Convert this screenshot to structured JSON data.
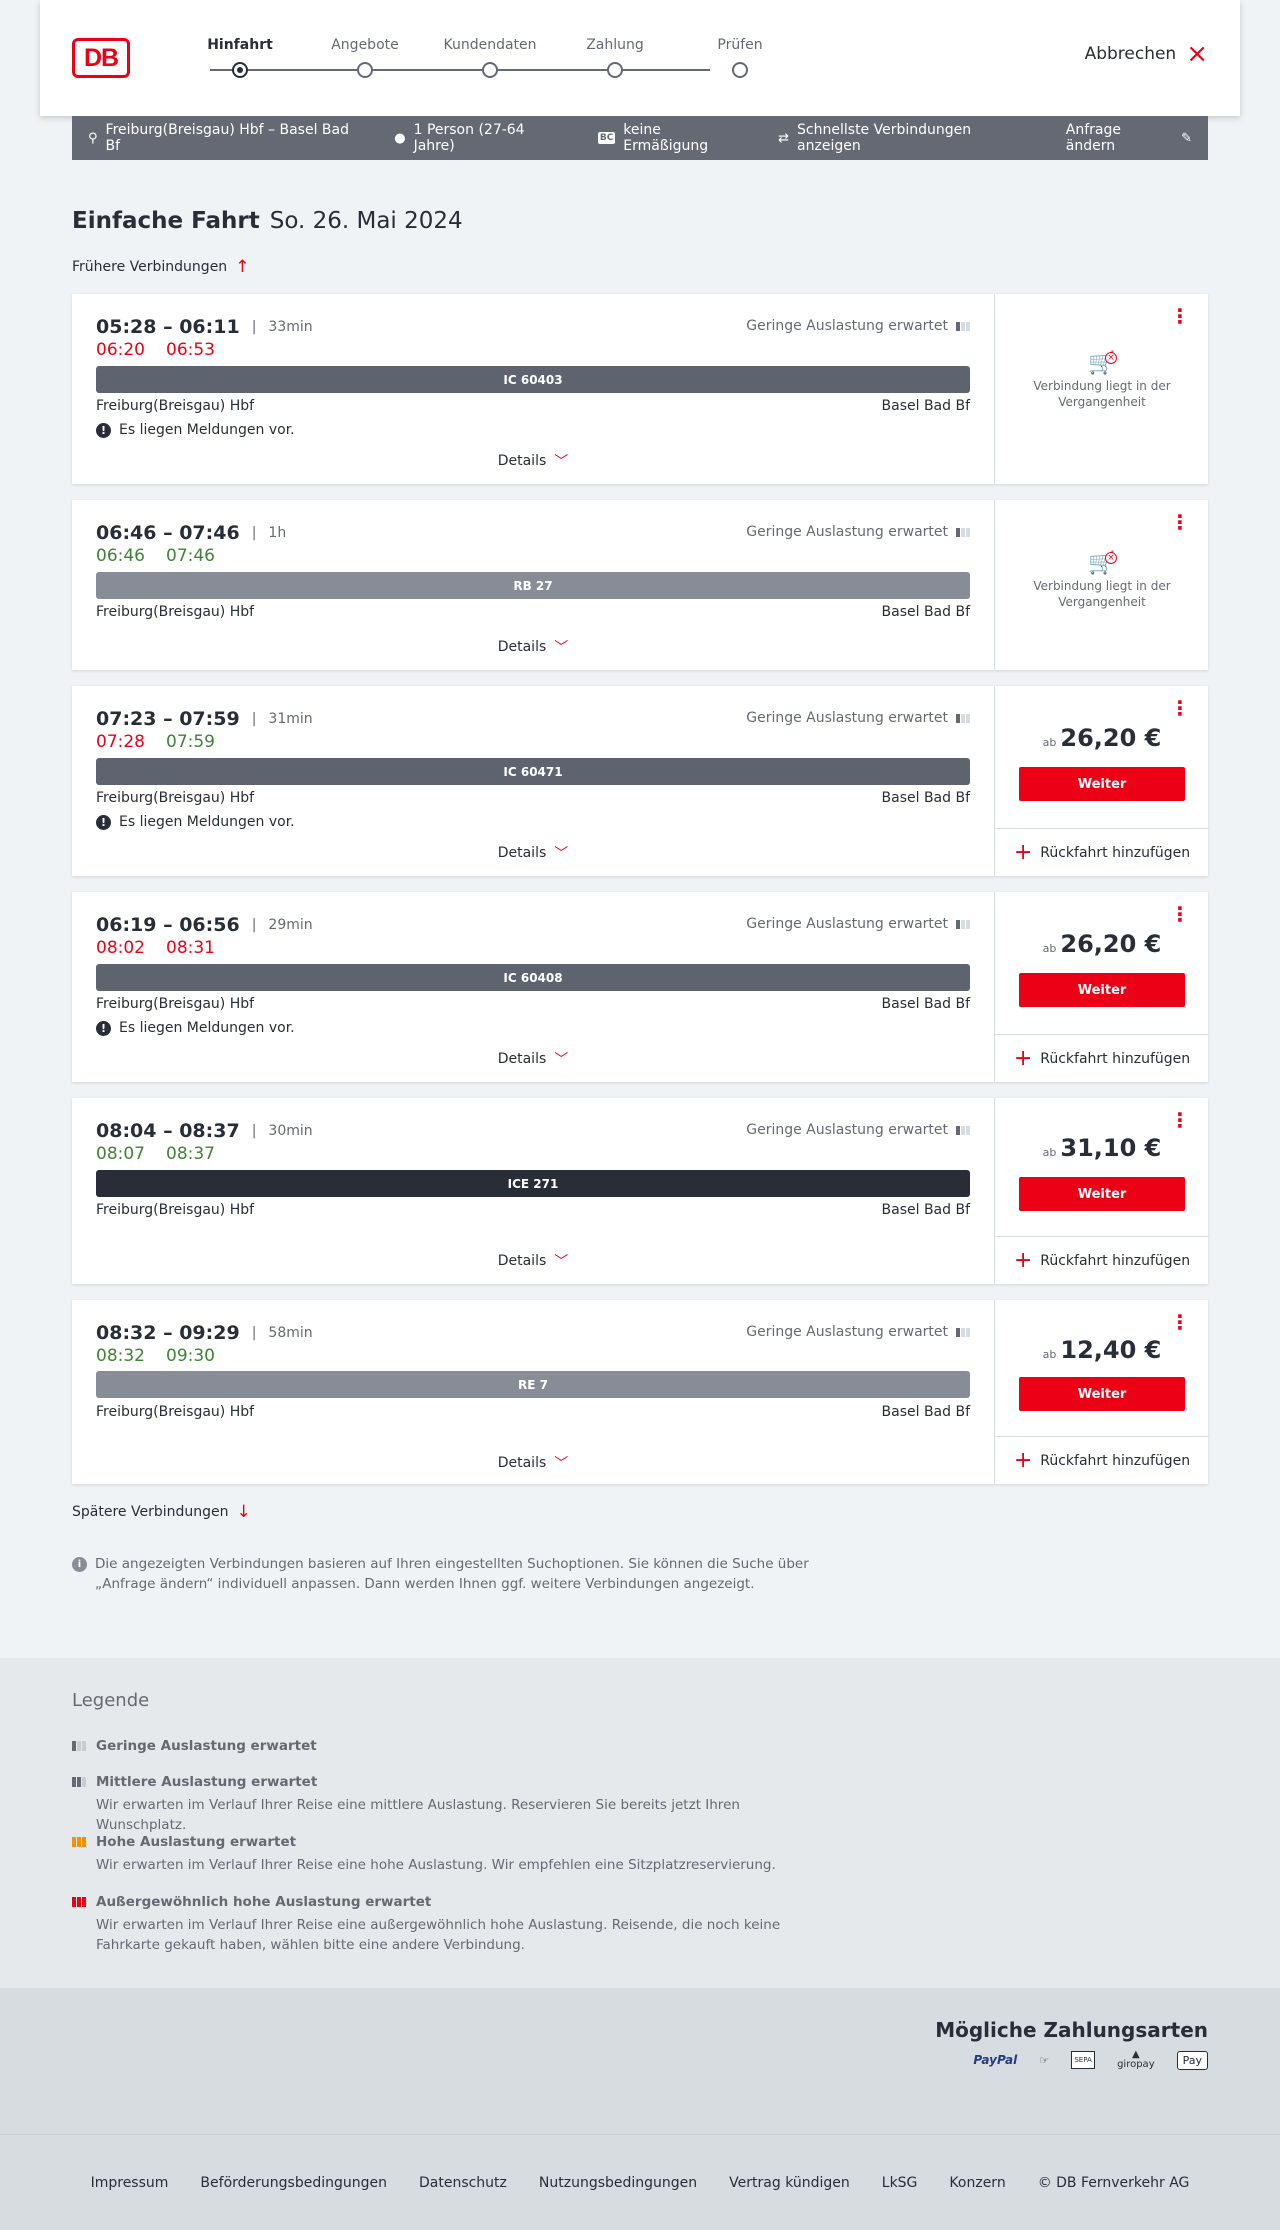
{
  "header": {
    "logo": "DB",
    "steps": [
      "Hinfahrt",
      "Angebote",
      "Kundendaten",
      "Zahlung",
      "Prüfen"
    ],
    "cancel_label": "Abbrechen"
  },
  "summary": {
    "route": "Freiburg(Breisgau) Hbf – Basel Bad Bf",
    "passengers": "1 Person (27-64 Jahre)",
    "discount_badge": "BC",
    "discount": "keine Ermäßigung",
    "option": "Schnellste Verbindungen anzeigen",
    "change": "Anfrage ändern"
  },
  "heading": {
    "title": "Einfache Fahrt",
    "date": "So. 26. Mai 2024"
  },
  "earlier_label": "Frühere Verbindungen",
  "later_label": "Spätere Verbindungen",
  "connections": [
    {
      "times": "05:28 – 06:11",
      "duration": "33min",
      "rt_dep": "06:20",
      "rt_arr": "06:53",
      "rt_color": "red",
      "load": "Geringe Auslastung erwartet",
      "train": "IC 60403",
      "from": "Freiburg(Breisgau) Hbf",
      "to": "Basel Bad Bf",
      "message": "Es liegen Meldungen vor.",
      "details": "Details",
      "past": "Verbindung liegt in der Vergangenheit"
    },
    {
      "times": "06:46 – 07:46",
      "duration": "1h",
      "rt_dep": "06:46",
      "rt_arr": "07:46",
      "rt_color": "green",
      "load": "Geringe Auslastung erwartet",
      "train": "RB 27",
      "from": "Freiburg(Breisgau) Hbf",
      "to": "Basel Bad Bf",
      "details": "Details",
      "past": "Verbindung liegt in der Vergangenheit"
    },
    {
      "times": "07:23 – 07:59",
      "duration": "31min",
      "rt_dep": "07:28",
      "rt_arr": "07:59",
      "load": "Geringe Auslastung erwartet",
      "train": "IC 60471",
      "from": "Freiburg(Breisgau) Hbf",
      "to": "Basel Bad Bf",
      "message": "Es liegen Meldungen vor.",
      "details": "Details",
      "price_prefix": "ab",
      "price": "26,20 €",
      "cta": "Weiter",
      "return": "Rückfahrt hinzufügen"
    },
    {
      "times": "06:19 – 06:56",
      "duration": "29min",
      "rt_dep": "08:02",
      "rt_arr": "08:31",
      "load": "Geringe Auslastung erwartet",
      "train": "IC 60408",
      "from": "Freiburg(Breisgau) Hbf",
      "to": "Basel Bad Bf",
      "message": "Es liegen Meldungen vor.",
      "details": "Details",
      "price_prefix": "ab",
      "price": "26,20 €",
      "cta": "Weiter",
      "return": "Rückfahrt hinzufügen"
    },
    {
      "times": "08:04 – 08:37",
      "duration": "30min",
      "rt_dep": "08:07",
      "rt_arr": "08:37",
      "load": "Geringe Auslastung erwartet",
      "train": "ICE 271",
      "from": "Freiburg(Breisgau) Hbf",
      "to": "Basel Bad Bf",
      "details": "Details",
      "price_prefix": "ab",
      "price": "31,10 €",
      "cta": "Weiter",
      "return": "Rückfahrt hinzufügen"
    },
    {
      "times": "08:32 – 09:29",
      "duration": "58min",
      "rt_dep": "08:32",
      "rt_arr": "09:30",
      "load": "Geringe Auslastung erwartet",
      "train": "RE 7",
      "from": "Freiburg(Breisgau) Hbf",
      "to": "Basel Bad Bf",
      "details": "Details",
      "price_prefix": "ab",
      "price": "12,40 €",
      "cta": "Weiter",
      "return": "Rückfahrt hinzufügen"
    }
  ],
  "info_text": "Die angezeigten Verbindungen basieren auf Ihren eingestellten Suchoptionen. Sie können die Suche über „Anfrage ändern“ individuell anpassen. Dann werden Ihnen ggf. weitere Verbindungen angezeigt.",
  "legend": {
    "title": "Legende",
    "items": [
      {
        "title": "Geringe Auslastung erwartet",
        "text": ""
      },
      {
        "title": "Mittlere Auslastung erwartet",
        "text": "Wir erwarten im Verlauf Ihrer Reise eine mittlere Auslastung. Reservieren Sie bereits jetzt Ihren Wunschplatz."
      },
      {
        "title": "Hohe Auslastung erwartet",
        "text": "Wir erwarten im Verlauf Ihrer Reise eine hohe Auslastung. Wir empfehlen eine Sitzplatzreservierung."
      },
      {
        "title": "Außergewöhnlich hohe Auslastung erwartet",
        "text": "Wir erwarten im Verlauf Ihrer Reise eine außergewöhnlich hohe Auslastung. Reisende, die noch keine Fahrkarte gekauft haben, wählen bitte eine andere Verbindung."
      }
    ]
  },
  "payments": {
    "title": "Mögliche Zahlungsarten",
    "methods": [
      "PayPal",
      "SEPA",
      "giropay",
      "Pay"
    ]
  },
  "footer": {
    "links": [
      "Impressum",
      "Beförderungsbedingungen",
      "Datenschutz",
      "Nutzungsbedingungen",
      "Vertrag kündigen",
      "LkSG",
      "Konzern",
      "© DB Fernverkehr AG"
    ]
  },
  "colors": {
    "brand": "#ec0016",
    "delay": "#ec0016",
    "on_time": "#408335"
  }
}
